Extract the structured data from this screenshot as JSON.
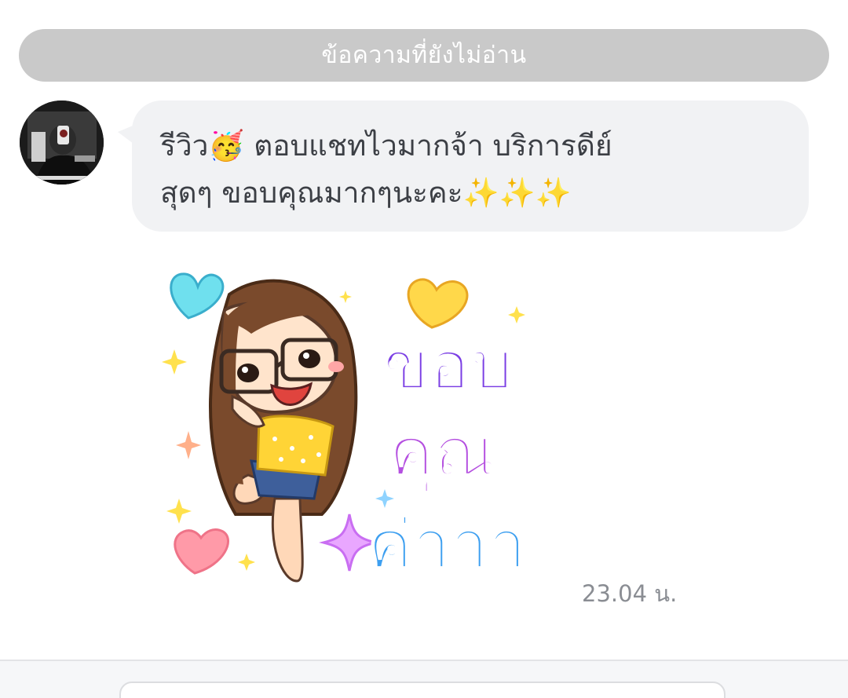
{
  "divider": {
    "unread_label": "ข้อความที่ยังไม่อ่าน"
  },
  "message": {
    "text": "รีวิว🥳 ตอบแชทไวมากจ้า บริการดีย์\nสุดๆ ขอบคุณมากๆนะคะ✨✨✨",
    "sender_avatar_icon": "user-avatar"
  },
  "sticker": {
    "lines": [
      "ขอบ",
      "คุณ",
      "ค่าาา"
    ],
    "icon": "thank-you-girl-sticker"
  },
  "meta": {
    "timestamp": "23.04 น."
  },
  "composer": {
    "value": "",
    "placeholder": ""
  },
  "colors": {
    "divider_bg": "#c9c9c9",
    "bubble_bg": "#f1f2f4",
    "text": "#3c3f45",
    "timestamp": "#8a8d93",
    "sticker_purple": "#7b3fe4",
    "sticker_violet": "#b44fe0",
    "sticker_blue": "#3d9ff0"
  }
}
